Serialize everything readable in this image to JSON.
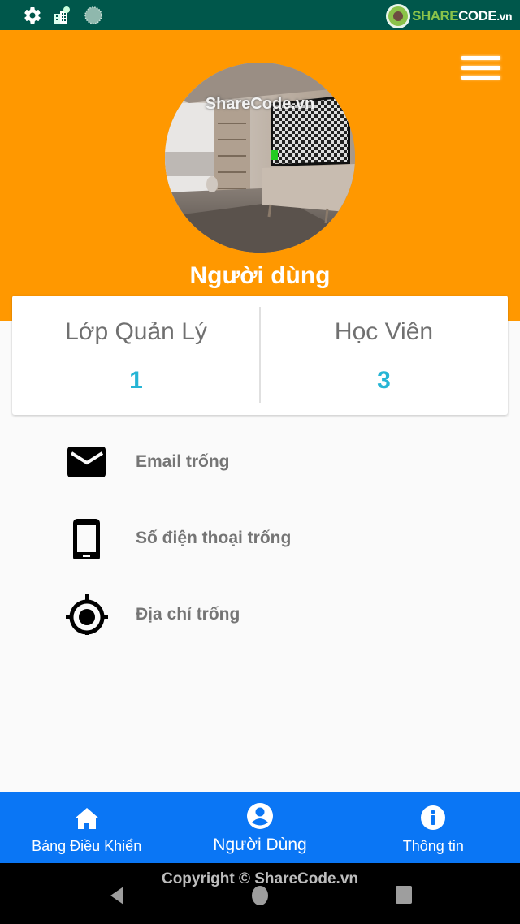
{
  "status_bar": {
    "icons": [
      "gear-icon",
      "city-icon",
      "circle-icon"
    ],
    "watermark": {
      "brand": "SHARE",
      "brand2": "CODE",
      "suffix": ".vn"
    }
  },
  "header": {
    "menu_icon": "hamburger-menu-icon",
    "avatar_watermark": "ShareCode.vn",
    "username": "Người dùng",
    "background_color": "#ff9800"
  },
  "stats": [
    {
      "label": "Lớp Quản Lý",
      "value": "1"
    },
    {
      "label": "Học Viên",
      "value": "3"
    }
  ],
  "stats_value_color": "#26b5d5",
  "info": [
    {
      "icon": "email-icon",
      "text": "Email trống"
    },
    {
      "icon": "phone-icon",
      "text": "Số điện thoại trống"
    },
    {
      "icon": "location-icon",
      "text": "Địa chỉ trống"
    }
  ],
  "bottom_nav": {
    "background_color": "#0a76f5",
    "items": [
      {
        "icon": "home-icon",
        "label": "Bảng Điều Khiển",
        "active": false
      },
      {
        "icon": "user-icon",
        "label": "Người Dùng",
        "active": true
      },
      {
        "icon": "info-icon",
        "label": "Thông tin",
        "active": false
      }
    ]
  },
  "system_nav": {
    "copyright": "Copyright © ShareCode.vn"
  }
}
